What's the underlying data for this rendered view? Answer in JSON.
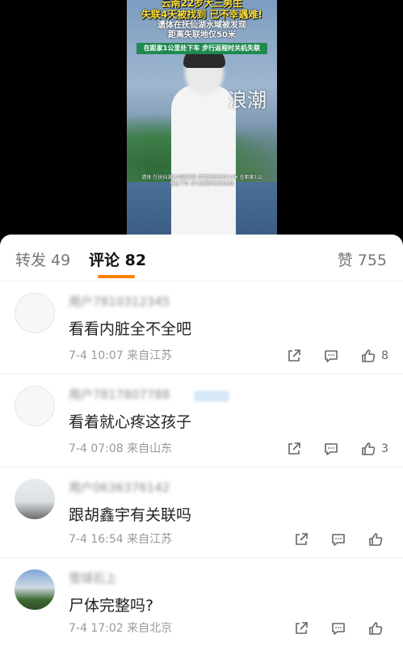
{
  "video": {
    "title_line1": "云南22岁大三男生",
    "title_line2": "失联4天被找到 已不幸遇难!",
    "subtitle_line1": "遗体在抚仙湖水域被发现",
    "subtitle_line2": "距离失联地仅50米",
    "banner": "在距家1公里处下车 步行返程时关机失联",
    "watermark": "浪潮",
    "caption": "遗体 在抚仙湖水域被发现 距离失联地仅50米 在距家1公里处下车 步行返程时关机失联"
  },
  "tabs": {
    "repost": "转发 49",
    "comments": "评论 82",
    "likes": "赞 755"
  },
  "colors": {
    "accent": "#ff8200",
    "text": "#222222",
    "meta": "#999999"
  },
  "comments": [
    {
      "username": "用户7810312345",
      "text": "看看内脏全不全吧",
      "time": "7-4 10:07",
      "location": "来自江苏",
      "likes": "8",
      "avatar": "blank-avatar"
    },
    {
      "username": "用户7817807788",
      "text": "看着就心疼这孩子",
      "time": "7-4 07:08",
      "location": "来自山东",
      "likes": "3",
      "avatar": "blank-avatar"
    },
    {
      "username": "用户0636376142",
      "text": "跟胡鑫宇有关联吗",
      "time": "7-4 16:54",
      "location": "来自江苏",
      "likes": "",
      "avatar": "photo-avatar"
    },
    {
      "username": "雪球石上",
      "text": "尸体完整吗?",
      "time": "7-4 17:02",
      "location": "来自北京",
      "likes": "",
      "avatar": "sky-avatar"
    }
  ],
  "icons": {
    "share": "share-icon",
    "reply": "comment-icon",
    "like": "thumbs-up-icon"
  }
}
